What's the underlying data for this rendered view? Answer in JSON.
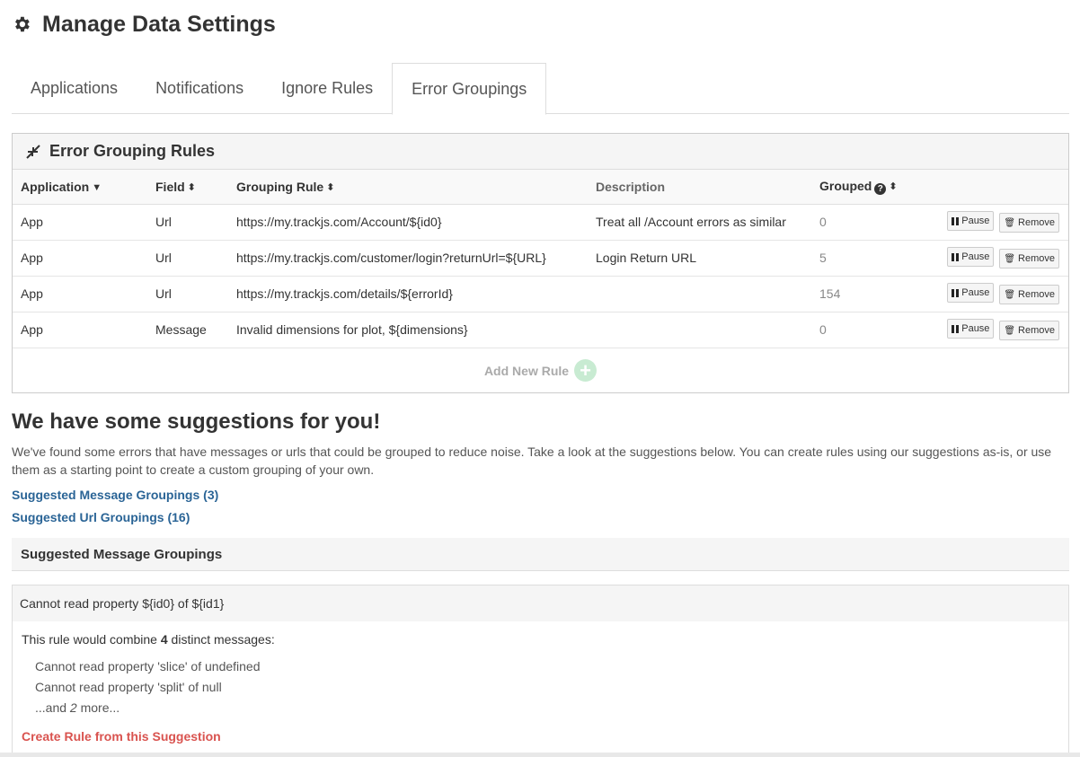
{
  "page": {
    "title": "Manage Data Settings"
  },
  "tabs": [
    {
      "label": "Applications",
      "active": false
    },
    {
      "label": "Notifications",
      "active": false
    },
    {
      "label": "Ignore Rules",
      "active": false
    },
    {
      "label": "Error Groupings",
      "active": true
    }
  ],
  "rules_panel": {
    "title": "Error Grouping Rules",
    "columns": {
      "application": "Application",
      "field": "Field",
      "grouping_rule": "Grouping Rule",
      "description": "Description",
      "grouped": "Grouped"
    },
    "rows": [
      {
        "application": "App",
        "field": "Url",
        "rule": "https://my.trackjs.com/Account/${id0}",
        "description": "Treat all /Account errors as similar",
        "grouped": "0"
      },
      {
        "application": "App",
        "field": "Url",
        "rule": "https://my.trackjs.com/customer/login?returnUrl=${URL}",
        "description": "Login Return URL",
        "grouped": "5"
      },
      {
        "application": "App",
        "field": "Url",
        "rule": "https://my.trackjs.com/details/${errorId}",
        "description": "",
        "grouped": "154"
      },
      {
        "application": "App",
        "field": "Message",
        "rule": "Invalid dimensions for plot, ${dimensions}",
        "description": "",
        "grouped": "0"
      }
    ],
    "pause_label": "Pause",
    "remove_label": "Remove",
    "add_new_label": "Add New Rule"
  },
  "suggestions": {
    "heading": "We have some suggestions for you!",
    "text": "We've found some errors that have messages or urls that could be grouped to reduce noise. Take a look at the suggestions below. You can create rules using our suggestions as-is, or use them as a starting point to create a custom grouping of your own.",
    "message_link": "Suggested Message Groupings (3)",
    "url_link": "Suggested Url Groupings (16)",
    "section_title": "Suggested Message Groupings",
    "card": {
      "rule": "Cannot read property ${id0} of ${id1}",
      "combine_prefix": "This rule would combine",
      "combine_count": "4",
      "combine_suffix": "distinct messages:",
      "examples": [
        "Cannot read property 'slice' of undefined",
        "Cannot read property 'split' of null"
      ],
      "more_prefix": "...and",
      "more_count": "2",
      "more_suffix": "more...",
      "create_label": "Create Rule from this Suggestion"
    }
  }
}
